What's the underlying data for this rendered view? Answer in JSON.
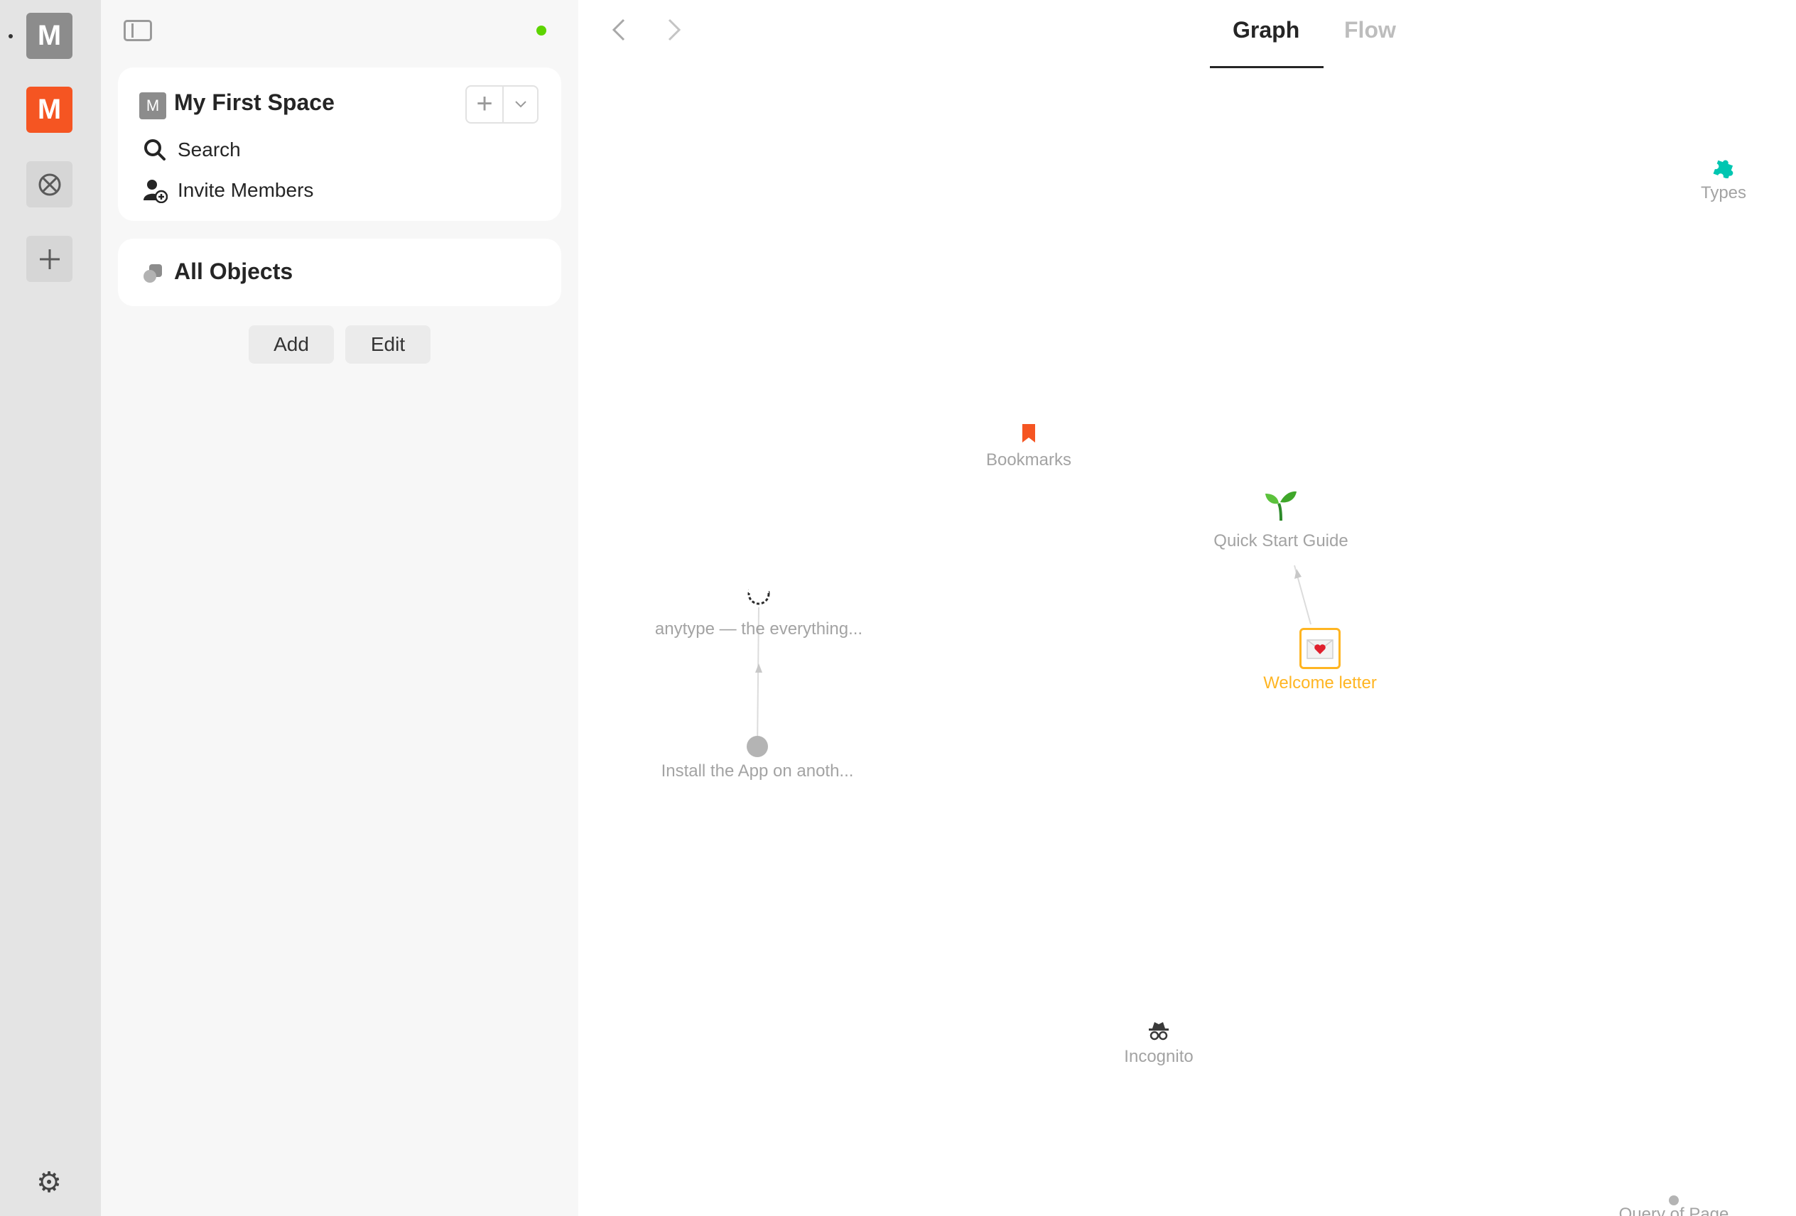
{
  "rail": {
    "vaults": [
      {
        "letter": "M",
        "color": "#8c8c8c",
        "active": true
      },
      {
        "letter": "M",
        "color": "#f55522"
      }
    ],
    "icons": [
      "no-symbol-icon",
      "plus-icon",
      "gear-icon"
    ]
  },
  "sidebar": {
    "space": {
      "icon_letter": "M",
      "name": "My First Space"
    },
    "menu": [
      {
        "label": "Search",
        "icon": "search-icon"
      },
      {
        "label": "Invite Members",
        "icon": "invite-user-icon"
      }
    ],
    "all_objects": {
      "label": "All Objects",
      "icon": "objects-icon"
    },
    "buttons": {
      "add": "Add",
      "edit": "Edit"
    }
  },
  "main": {
    "tabs": [
      {
        "label": "Graph",
        "active": true
      },
      {
        "label": "Flow",
        "active": false
      }
    ],
    "graph_nodes": [
      {
        "label": "Types",
        "icon": "puzzle-icon",
        "color": "#00c6b1"
      },
      {
        "label": "Bookmarks",
        "icon": "bookmark-icon",
        "color": "#f55522"
      },
      {
        "label": "Quick Start Guide",
        "icon": "seedling-icon",
        "color": "#3fa72a"
      },
      {
        "label": "Welcome letter",
        "icon": "love-letter-icon",
        "color": "#ffb522",
        "selected": true
      },
      {
        "label": "anytype — the everything...",
        "icon": "loading-smile-icon"
      },
      {
        "label": "Install the App on anoth...",
        "icon": "dot-icon"
      },
      {
        "label": "Incognito",
        "icon": "incognito-icon"
      },
      {
        "label": "Query of Page",
        "icon": "dot-icon"
      }
    ]
  }
}
